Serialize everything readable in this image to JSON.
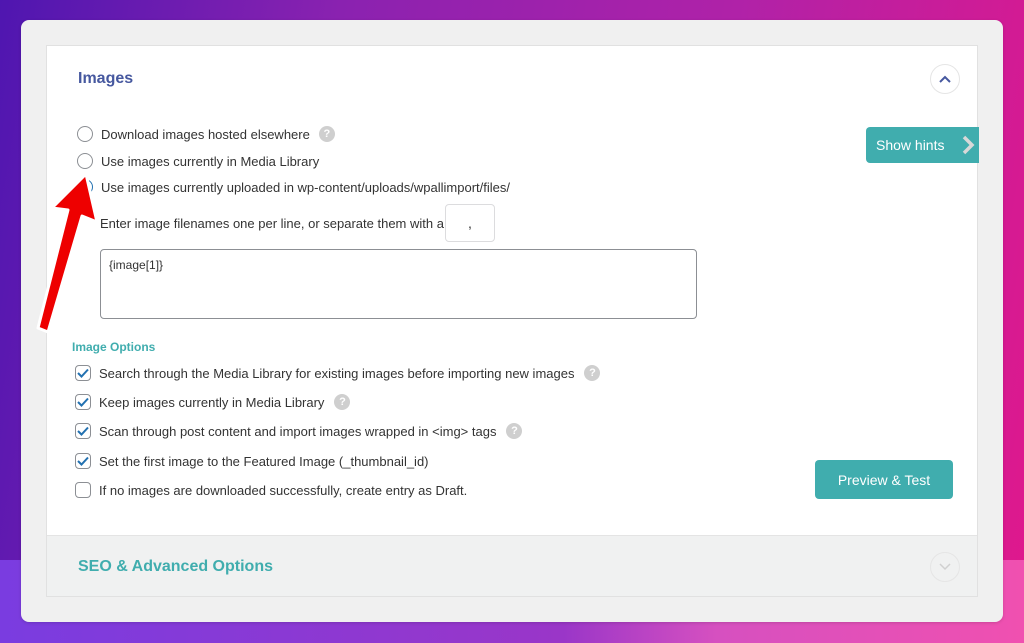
{
  "colors": {
    "accent": "#40adae",
    "title_blue": "#46589f",
    "radio_blue": "#2271b1",
    "annotation_arrow": "#ee0000"
  },
  "images_section": {
    "title": "Images",
    "collapse_icon": "chevron-up-icon",
    "show_hints_label": "Show hints",
    "radios": [
      {
        "label": "Download images hosted elsewhere",
        "checked": false,
        "help": true
      },
      {
        "label": "Use images currently in Media Library",
        "checked": false,
        "help": false
      },
      {
        "label": "Use images currently uploaded in wp-content/uploads/wpallimport/files/",
        "checked": true,
        "help": false
      }
    ],
    "delimiter_prompt": "Enter image filenames one per line, or separate them with a",
    "delimiter_value": ",",
    "filenames_value": "{image[1]}",
    "image_options_heading": "Image Options",
    "options": [
      {
        "label": "Search through the Media Library for existing images before importing new images",
        "checked": true,
        "help": true
      },
      {
        "label": "Keep images currently in Media Library",
        "checked": true,
        "help": true
      },
      {
        "label": "Scan through post content and import images wrapped in <img> tags",
        "checked": true,
        "help": true
      },
      {
        "label": "Set the first image to the Featured Image (_thumbnail_id)",
        "checked": true,
        "help": false
      },
      {
        "label": "If no images are downloaded successfully, create entry as Draft.",
        "checked": false,
        "help": false
      }
    ],
    "preview_button_label": "Preview & Test",
    "help_glyph": "?"
  },
  "seo_section": {
    "title": "SEO & Advanced Options",
    "expand_icon": "chevron-down-icon"
  }
}
